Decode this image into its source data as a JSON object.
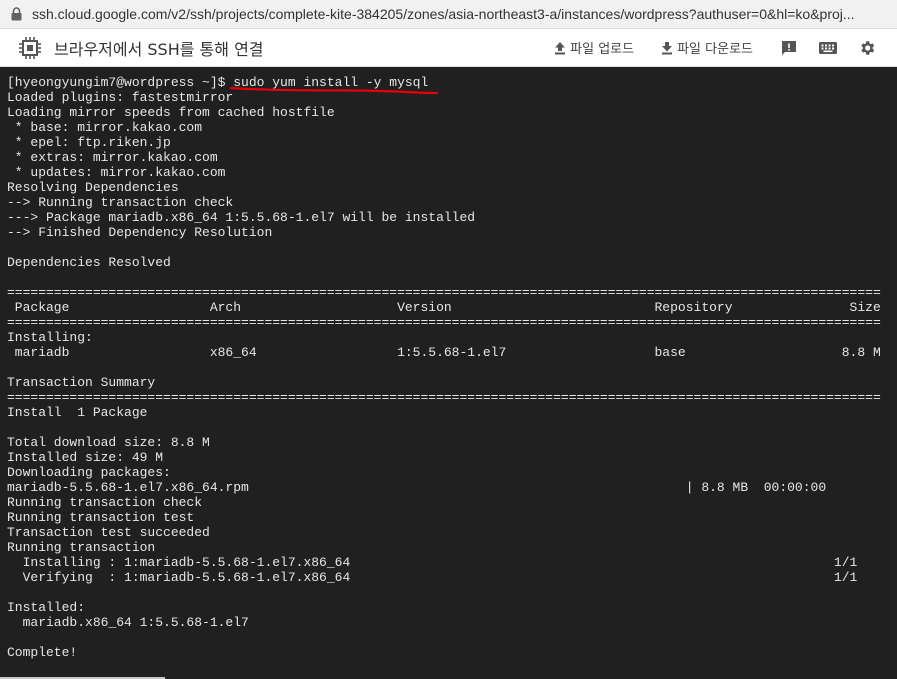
{
  "browser": {
    "url": "ssh.cloud.google.com/v2/ssh/projects/complete-kite-384205/zones/asia-northeast3-a/instances/wordpress?authuser=0&hl=ko&proj..."
  },
  "toolbar": {
    "title": "브라우저에서 SSH를 통해 연결",
    "upload_label": "파일 업로드",
    "download_label": "파일 다운로드",
    "icons": [
      "chip-icon",
      "upload-icon",
      "download-icon",
      "feedback-icon",
      "keyboard-icon",
      "settings-icon"
    ]
  },
  "terminal": {
    "lines": [
      "[hyeongyungim7@wordpress ~]$ sudo yum install -y mysql",
      "Loaded plugins: fastestmirror",
      "Loading mirror speeds from cached hostfile",
      " * base: mirror.kakao.com",
      " * epel: ftp.riken.jp",
      " * extras: mirror.kakao.com",
      " * updates: mirror.kakao.com",
      "Resolving Dependencies",
      "--> Running transaction check",
      "---> Package mariadb.x86_64 1:5.5.68-1.el7 will be installed",
      "--> Finished Dependency Resolution",
      "",
      "Dependencies Resolved",
      "",
      "================================================================================================================",
      " Package                  Arch                    Version                          Repository               Size",
      "================================================================================================================",
      "Installing:",
      " mariadb                  x86_64                  1:5.5.68-1.el7                   base                    8.8 M",
      "",
      "Transaction Summary",
      "================================================================================================================",
      "Install  1 Package",
      "",
      "Total download size: 8.8 M",
      "Installed size: 49 M",
      "Downloading packages:",
      "mariadb-5.5.68-1.el7.x86_64.rpm                                                        | 8.8 MB  00:00:00",
      "Running transaction check",
      "Running transaction test",
      "Transaction test succeeded",
      "Running transaction",
      "  Installing : 1:mariadb-5.5.68-1.el7.x86_64                                                              1/1",
      "  Verifying  : 1:mariadb-5.5.68-1.el7.x86_64                                                              1/1",
      "",
      "Installed:",
      "  mariadb.x86_64 1:5.5.68-1.el7",
      "",
      "Complete!"
    ]
  },
  "colors": {
    "terminal_bg": "#202020",
    "terminal_fg": "#e6e6e6",
    "annotation": "#e8000a",
    "toolbar_icon": "#555555"
  }
}
